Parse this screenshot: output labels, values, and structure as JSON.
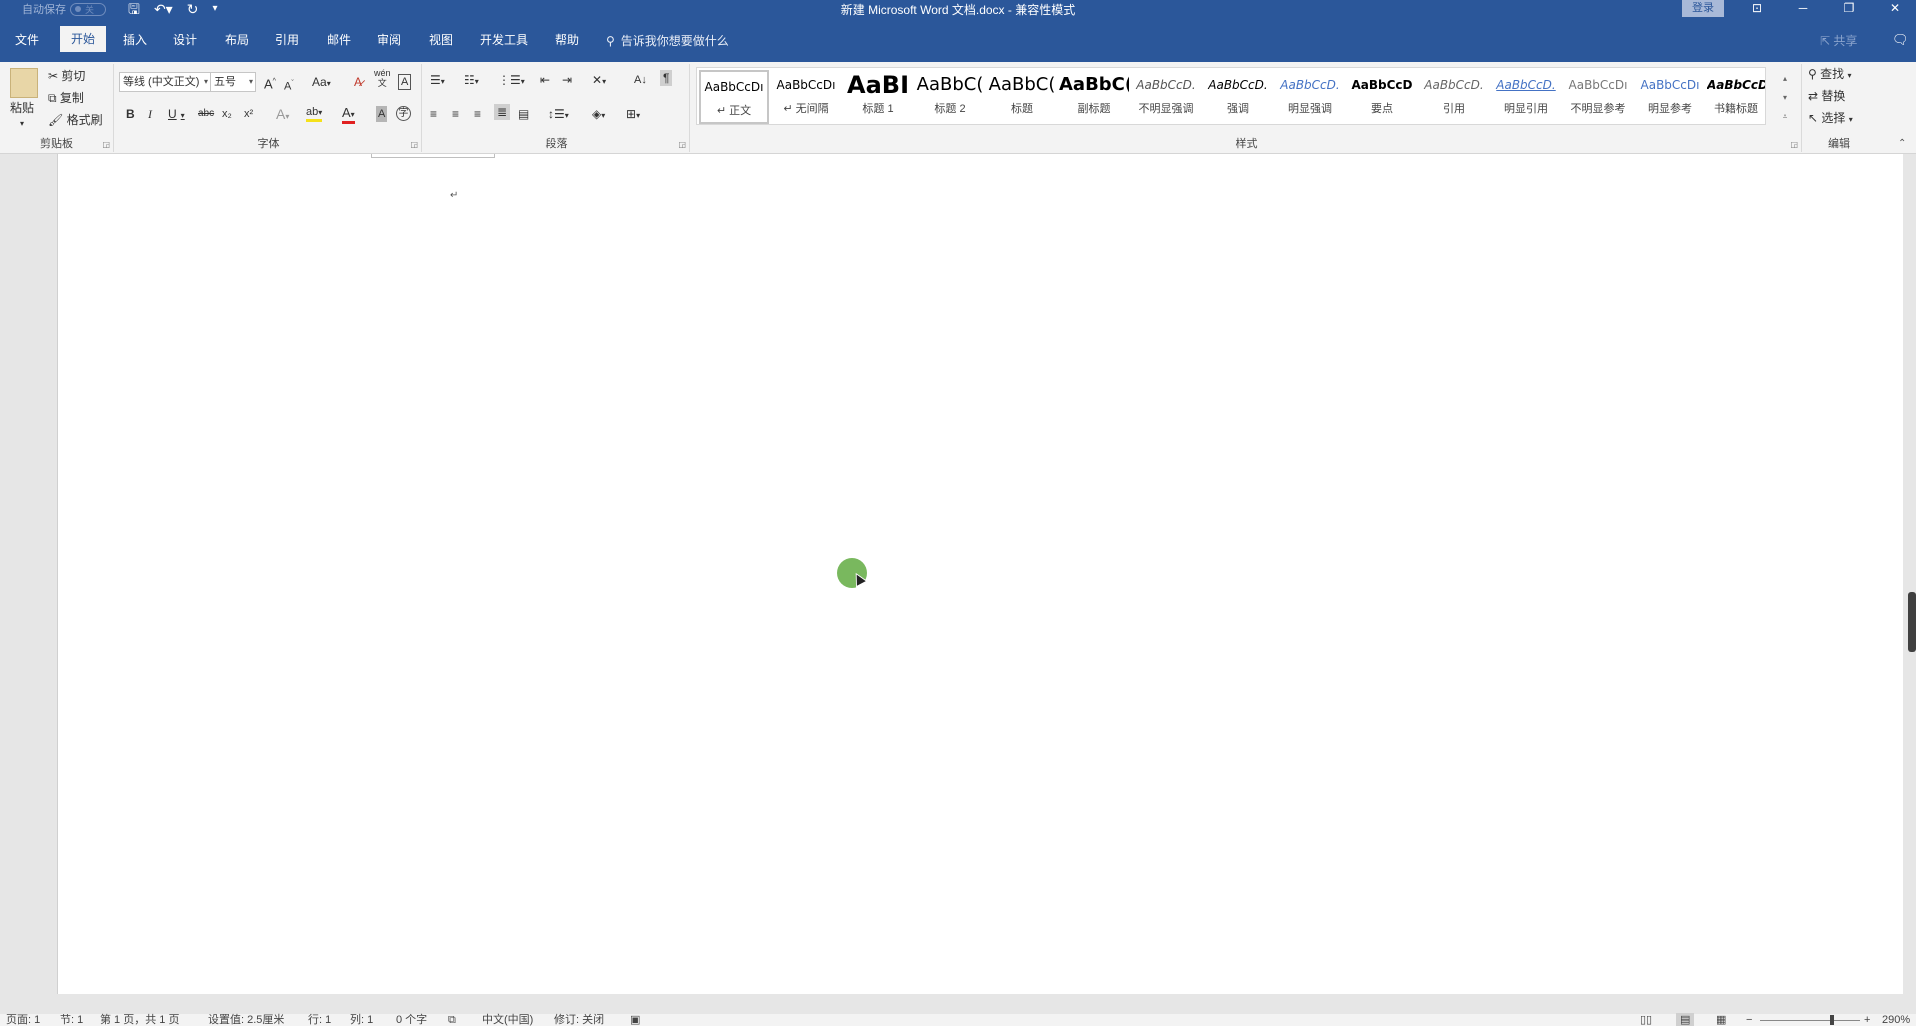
{
  "titlebar": {
    "autosave_label": "自动保存",
    "autosave_state": "关",
    "qat_icons": [
      "save-icon",
      "undo-icon",
      "redo-icon",
      "customize-icon"
    ],
    "document_title": "新建 Microsoft Word 文档.docx  -  兼容性模式",
    "login_label": "登录",
    "window_icons": [
      "ribbon-display-icon",
      "minimize-icon",
      "restore-icon",
      "close-icon"
    ]
  },
  "tabs": [
    {
      "label": "文件",
      "active": false
    },
    {
      "label": "开始",
      "active": true
    },
    {
      "label": "插入",
      "active": false
    },
    {
      "label": "设计",
      "active": false
    },
    {
      "label": "布局",
      "active": false
    },
    {
      "label": "引用",
      "active": false
    },
    {
      "label": "邮件",
      "active": false
    },
    {
      "label": "审阅",
      "active": false
    },
    {
      "label": "视图",
      "active": false
    },
    {
      "label": "开发工具",
      "active": false
    },
    {
      "label": "帮助",
      "active": false
    }
  ],
  "tellme": {
    "placeholder": "告诉我你想要做什么"
  },
  "share_label": "共享",
  "ribbon": {
    "clipboard": {
      "label": "剪贴板",
      "paste": "粘贴",
      "cut": "剪切",
      "copy": "复制",
      "format_painter": "格式刷"
    },
    "font": {
      "label": "字体",
      "font_name": "等线 (中文正文)",
      "font_size": "五号",
      "change_case": "Aa",
      "phonetic_top": "wén",
      "phonetic_bottom": "文",
      "bold": "B",
      "italic": "I",
      "underline": "U",
      "strike": "abc",
      "subscript": "x₂",
      "superscript": "x²",
      "text_effect": "A",
      "highlight": "ab",
      "font_color": "A",
      "char_shading": "A",
      "enclose": "字",
      "grow": "A",
      "shrink": "A"
    },
    "paragraph": {
      "label": "段落"
    },
    "styles": {
      "label": "样式",
      "items": [
        {
          "preview": "AaBbCcDı",
          "name": "↵ 正文",
          "selected": true
        },
        {
          "preview": "AaBbCcDı",
          "name": "↵ 无间隔",
          "selected": false
        },
        {
          "preview": "AaBI",
          "name": "标题 1",
          "selected": false
        },
        {
          "preview": "AaBbC(",
          "name": "标题 2",
          "selected": false
        },
        {
          "preview": "AaBbC(",
          "name": "标题",
          "selected": false
        },
        {
          "preview": "AaBbC(",
          "name": "副标题",
          "selected": false
        },
        {
          "preview": "AaBbCcD.",
          "name": "不明显强调",
          "selected": false
        },
        {
          "preview": "AaBbCcD.",
          "name": "强调",
          "selected": false
        },
        {
          "preview": "AaBbCcD.",
          "name": "明显强调",
          "selected": false
        },
        {
          "preview": "AaBbCcD",
          "name": "要点",
          "selected": false
        },
        {
          "preview": "AaBbCcD.",
          "name": "引用",
          "selected": false
        },
        {
          "preview": "AaBbCcD.",
          "name": "明显引用",
          "selected": false
        },
        {
          "preview": "AaBbCcDı",
          "name": "不明显参考",
          "selected": false
        },
        {
          "preview": "AaBbCcDı",
          "name": "明显参考",
          "selected": false
        },
        {
          "preview": "AaBbCcD",
          "name": "书籍标题",
          "selected": false
        }
      ]
    },
    "editing": {
      "label": "编辑",
      "find": "查找",
      "replace": "替换",
      "select": "选择"
    }
  },
  "document": {
    "paragraph_mark": "↵"
  },
  "statusbar": {
    "page": "页面: 1",
    "section": "节: 1",
    "page_of": "第 1 页，共 1 页",
    "position": "设置值: 2.5厘米",
    "line": "行: 1",
    "column": "列: 1",
    "word_count": "0 个字",
    "language": "中文(中国)",
    "track_changes": "修订: 关闭",
    "zoom_minus": "−",
    "zoom_plus": "+",
    "zoom": "290%"
  },
  "colors": {
    "brand": "#2b579a",
    "ribbon_bg": "#f3f3f3",
    "doc_bg": "#e6e6e6",
    "cursor_highlight": "#6ab04c"
  }
}
